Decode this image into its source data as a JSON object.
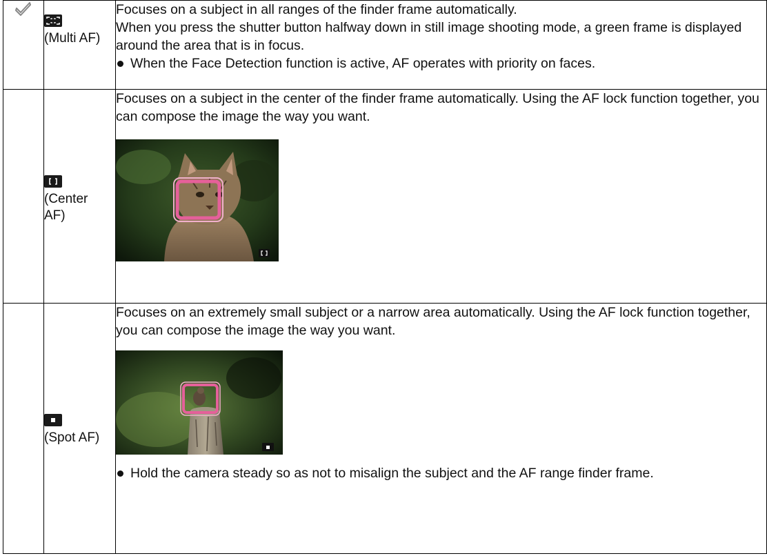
{
  "rows": [
    {
      "checked": true,
      "mode_label": "(Multi AF)",
      "icon": "multi-af-icon",
      "text1": "Focuses on a subject in all ranges of the finder frame automatically.",
      "text2": "When you press the shutter button halfway down in still image shooting mode, a green frame is displayed around the area that is in focus.",
      "bullet": "When the Face Detection function is active, AF operates with priority on faces."
    },
    {
      "checked": false,
      "mode_label": "(Center AF)",
      "icon": "center-af-icon",
      "text1": "Focuses on a subject in the center of the finder frame automatically. Using the AF lock function together, you can compose the image the way you want.",
      "photo": "cat-photo"
    },
    {
      "checked": false,
      "mode_label": "(Spot AF)",
      "icon": "spot-af-icon",
      "text1": "Focuses on an extremely small subject or a narrow area automatically. Using the AF lock function together, you can compose the image the way you want.",
      "photo": "bird-on-post-photo",
      "bullet": "Hold the camera steady so as not to misalign the subject and the AF range finder frame."
    }
  ],
  "colors": {
    "focus_frame": "#e5609a",
    "border": "#000000",
    "check": "#888888"
  }
}
